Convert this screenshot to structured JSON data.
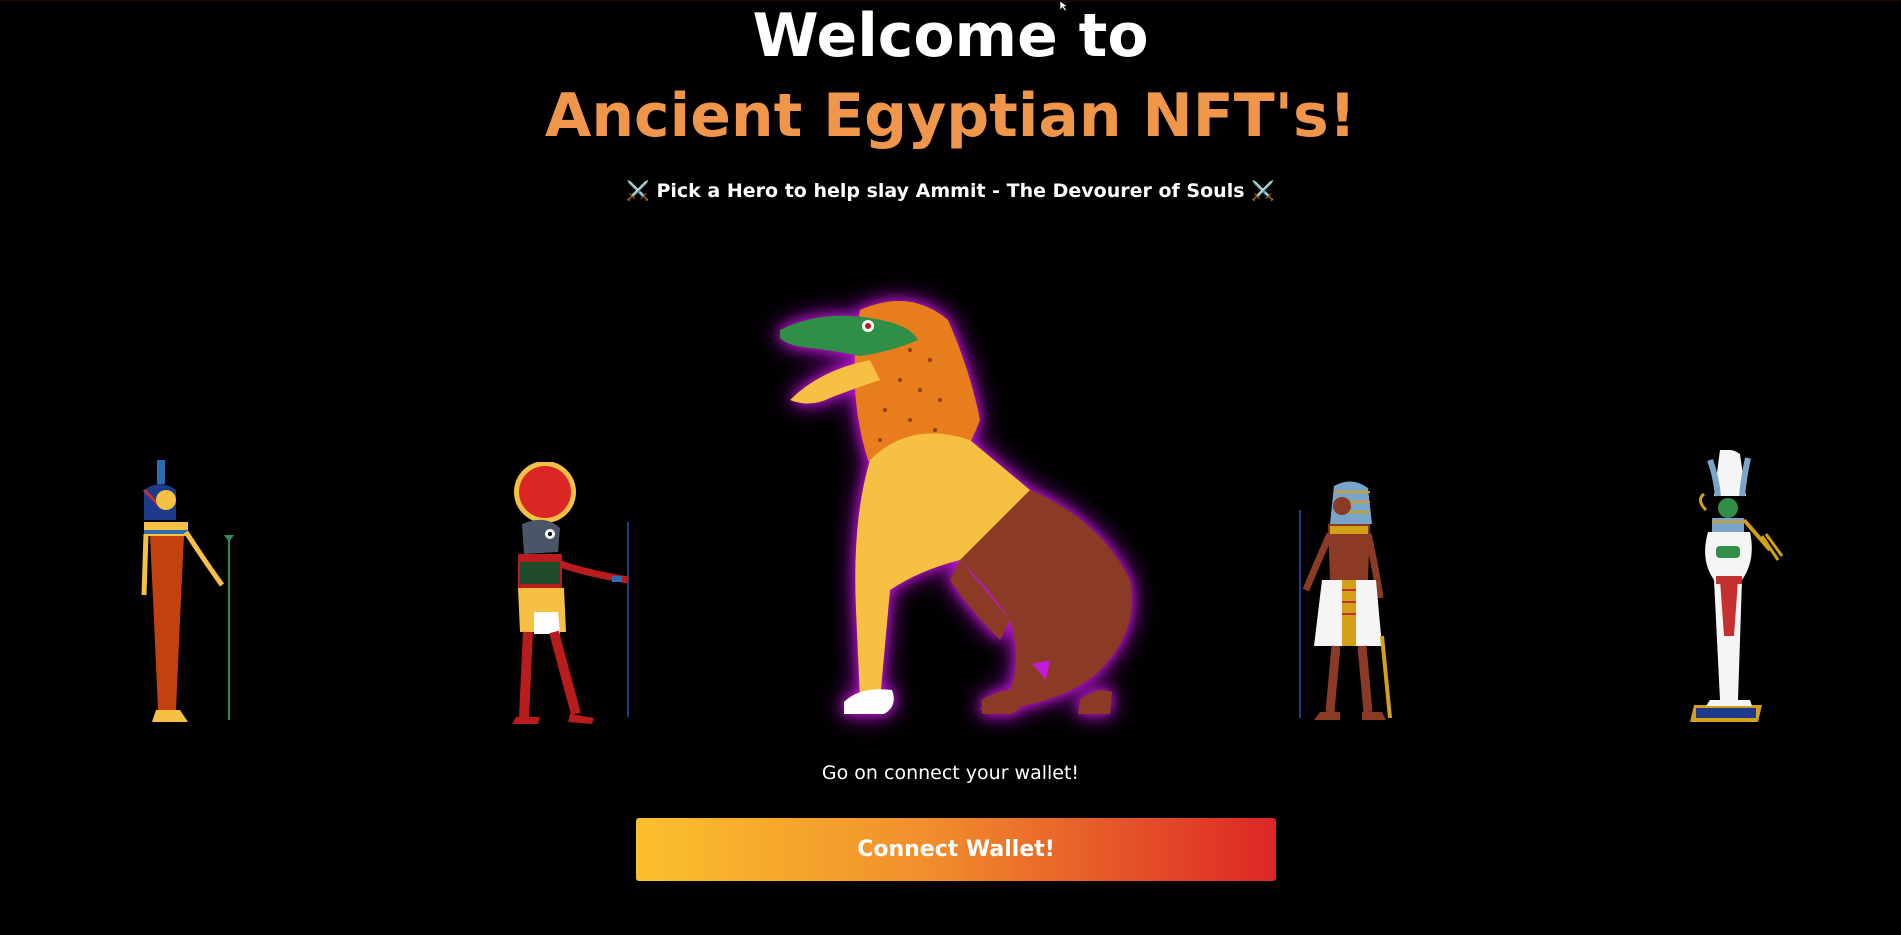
{
  "header": {
    "welcome": "Welcome to",
    "brand": "Ancient Egyptian NFT's!",
    "subtitle": "⚔️ Pick a Hero to help slay Ammit - The Devourer of Souls ⚔️"
  },
  "heroes": [
    {
      "id": "isis",
      "icon": "goddess-figure"
    },
    {
      "id": "ra",
      "icon": "falcon-headed-figure"
    },
    {
      "id": "pharaoh",
      "icon": "pharaoh-figure"
    },
    {
      "id": "osiris",
      "icon": "osiris-figure"
    }
  ],
  "boss": {
    "icon": "ammit-crocodile-lion-beast"
  },
  "cta": {
    "prompt": "Go on connect your wallet!",
    "button_label": "Connect Wallet!"
  },
  "colors": {
    "background": "#000000",
    "brand_orange": "#f0964a",
    "button_gradient_start": "#fbc02d",
    "button_gradient_end": "#dc2626",
    "boss_glow": "#c21bd6"
  }
}
